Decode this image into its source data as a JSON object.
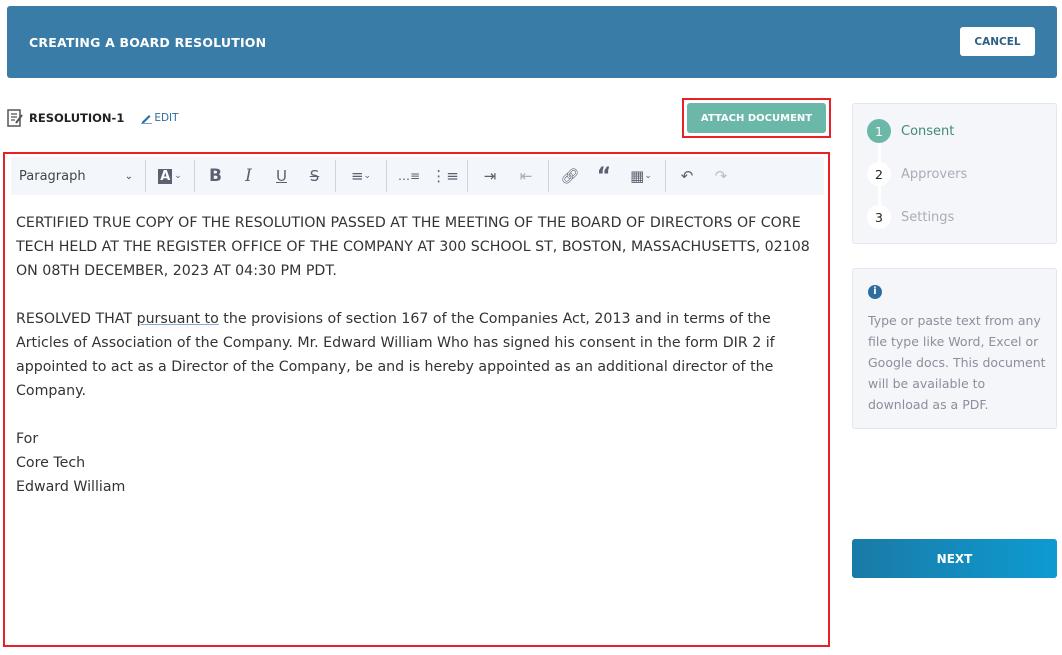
{
  "header": {
    "title": "CREATING A BOARD RESOLUTION",
    "cancel_label": "CANCEL",
    "bg_color": "#3a7ca8"
  },
  "document": {
    "name": "RESOLUTION-1",
    "edit_label": "EDIT",
    "attach_label": "ATTACH DOCUMENT"
  },
  "toolbar": {
    "block_format": "Paragraph",
    "icons": [
      "text-color-icon",
      "bold-icon",
      "italic-icon",
      "underline-icon",
      "strikethrough-icon",
      "align-icon",
      "numbered-list-icon",
      "bulleted-list-icon",
      "indent-icon",
      "outdent-icon",
      "link-icon",
      "blockquote-icon",
      "table-icon",
      "undo-icon",
      "redo-icon"
    ]
  },
  "content": {
    "p1": "CERTIFIED TRUE COPY OF THE RESOLUTION PASSED AT THE MEETING OF THE BOARD OF DIRECTORS OF CORE TECH HELD AT THE REGISTER OFFICE OF THE COMPANY AT  300 SCHOOL ST, BOSTON, MASSACHUSETTS, 02108 ON 08TH DECEMBER, 2023 AT 04:30 PM PDT.",
    "p2a": "RESOLVED THAT ",
    "p2b": "pursuant to",
    "p2c": " the provisions of section 167 of the Companies Act, 2013 and in terms of the Articles of Association of the Company. Mr. Edward William Who has signed his consent in the form DIR 2 if appointed to act as a Director of the Company, be and is hereby appointed as an additional director of the Company.",
    "sig1": "For",
    "sig2": "Core Tech",
    "sig3": "Edward William"
  },
  "steps": [
    {
      "num": "1",
      "label": "Consent",
      "active": true
    },
    {
      "num": "2",
      "label": "Approvers",
      "active": false
    },
    {
      "num": "3",
      "label": "Settings",
      "active": false
    }
  ],
  "info": {
    "text": "Type or paste text from any file type like Word, Excel or Google docs. This document will be available to download as a PDF."
  },
  "next_label": "NEXT",
  "colors": {
    "accent": "#6bb8a9",
    "highlight": "#e8202a"
  }
}
